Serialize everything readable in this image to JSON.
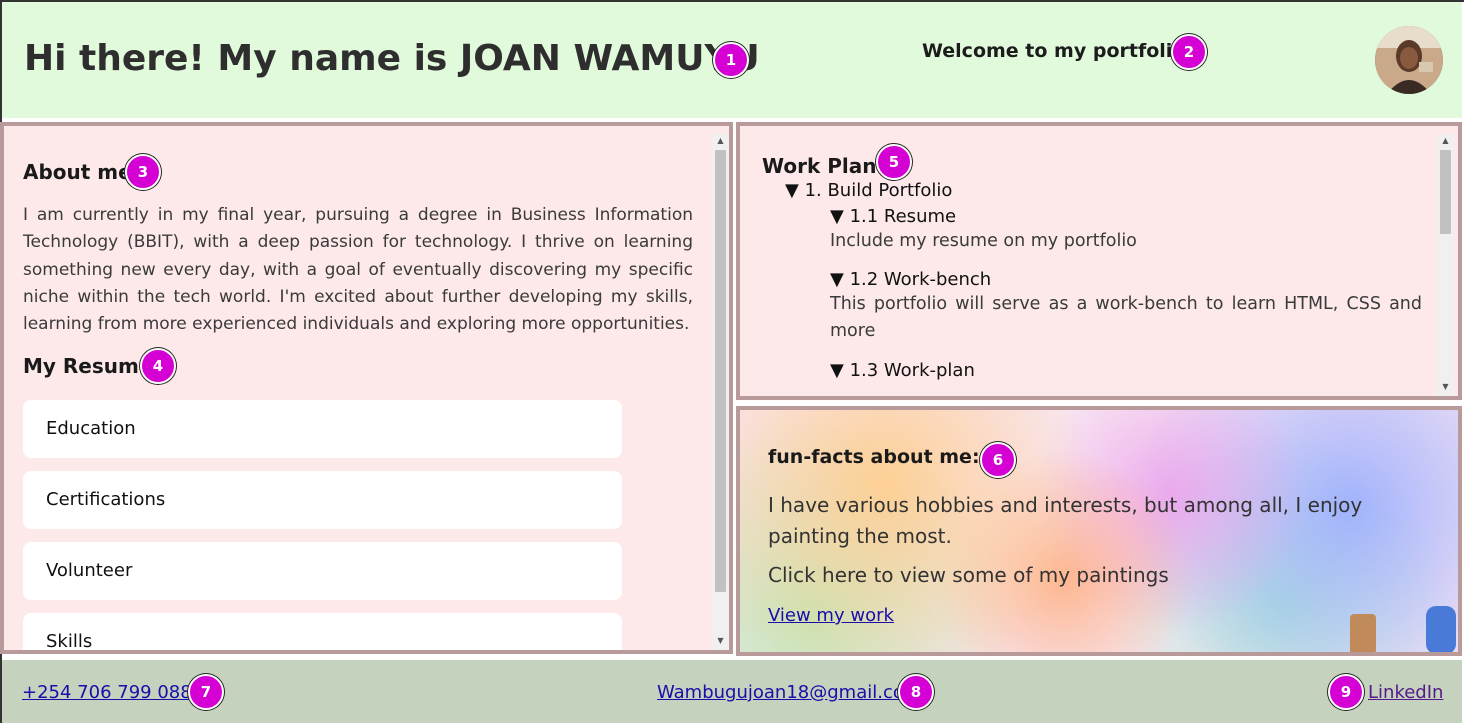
{
  "header": {
    "title": "Hi there! My name is JOAN WAMUYU",
    "welcome": "Welcome to my portfolio"
  },
  "badges": [
    "1",
    "2",
    "3",
    "4",
    "5",
    "6",
    "7",
    "8",
    "9"
  ],
  "about": {
    "heading": "About me",
    "text": "I am currently in my final year, pursuing a degree in Business Information Technology (BBIT), with a deep passion for technology. I thrive on learning something new every day, with a goal of eventually discovering my specific niche within the tech world. I'm excited about further developing my skills, learning from more experienced individuals and exploring more opportunities."
  },
  "resume": {
    "heading": "My Resume",
    "items": [
      "Education",
      "Certifications",
      "Volunteer",
      "Skills"
    ]
  },
  "workplan": {
    "heading": "Work Plan",
    "item1": "▼ 1. Build Portfolio",
    "sub1_title": "▼ 1.1 Resume",
    "sub1_desc": "Include my resume on my portfolio",
    "sub2_title": "▼ 1.2 Work-bench",
    "sub2_desc": "This portfolio will serve as a work-bench to learn HTML, CSS and more",
    "sub3_title": "▼ 1.3 Work-plan"
  },
  "funfacts": {
    "heading": "fun-facts about me:",
    "line1": "I have various hobbies and interests, but among all, I enjoy painting the most.",
    "line2": "Click here to view some of my paintings",
    "link": "View my work"
  },
  "footer": {
    "phone": "+254 706 799 088",
    "email": "Wambugujoan18@gmail.com",
    "linkedin": "LinkedIn"
  },
  "colors": {
    "badge": "#d400d4",
    "header_bg": "#e2fadc",
    "panel_bg": "#fde9e9",
    "footer_bg": "#c5d2bd",
    "link": "#1a0dab"
  }
}
